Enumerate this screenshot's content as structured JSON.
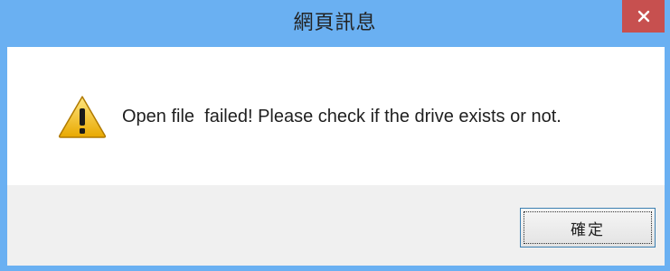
{
  "dialog": {
    "title": "網頁訊息",
    "message": "Open file  failed! Please check if the drive exists or not.",
    "ok_label": "確定"
  },
  "icons": {
    "close": "close-icon",
    "warning": "warning-icon"
  },
  "colors": {
    "titlebar": "#6ab0f2",
    "close_button": "#c7504f",
    "footer": "#f0f0f0",
    "warning_fill": "#f4c430"
  }
}
